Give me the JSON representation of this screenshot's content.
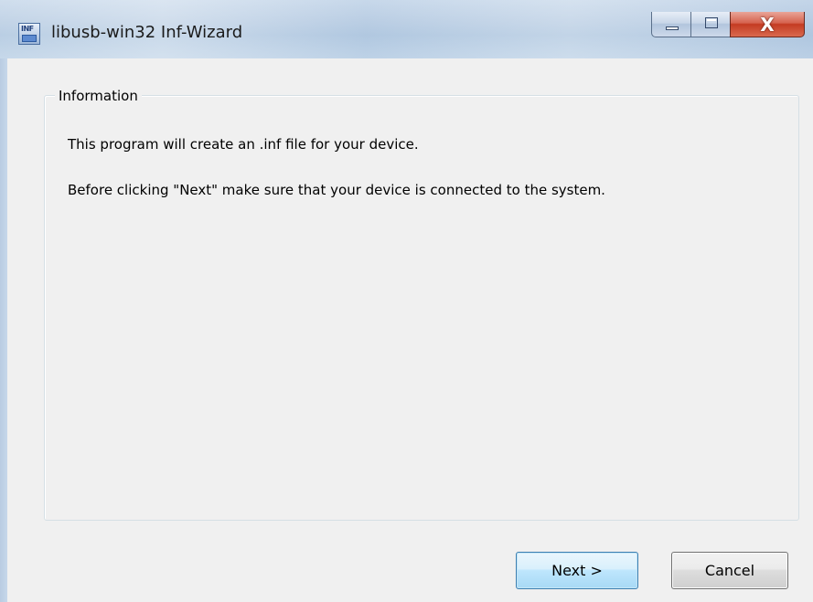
{
  "window": {
    "title": "libusb-win32 Inf-Wizard",
    "icon": "inf-file-icon",
    "close_glyph": "X"
  },
  "group": {
    "legend": "Information",
    "lines": [
      "This program will create an .inf file for your device.",
      "Before clicking \"Next\" make sure that your device is connected to the system."
    ]
  },
  "buttons": {
    "next_label": "Next >",
    "cancel_label": "Cancel"
  },
  "colors": {
    "client_bg": "#f0f0f0",
    "close_button": "#c43b22",
    "next_border": "#3c7fb1"
  }
}
